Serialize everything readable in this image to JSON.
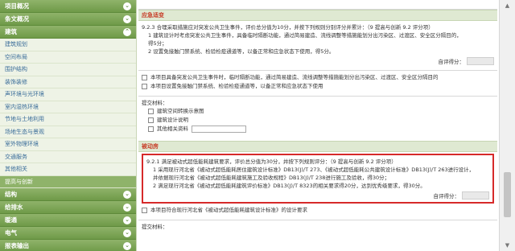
{
  "sidebar": {
    "sections": [
      {
        "label": "项目概况",
        "key": "project"
      },
      {
        "label": "条文概况",
        "key": "clause"
      },
      {
        "label": "建筑",
        "key": "arch"
      }
    ],
    "arch_items": [
      "建筑规划",
      "空间布局",
      "围护结构",
      "装饰装修",
      "声环境与光环境",
      "室内湿热环境",
      "节地与土地利用",
      "场地生态与景观",
      "室外物理环境",
      "交通服务",
      "其他相关",
      "提高与创新"
    ],
    "active_item": "提高与创新",
    "bottom_sections": [
      "结构",
      "给排水",
      "暖通",
      "电气",
      "报表输出"
    ]
  },
  "main": {
    "section1": {
      "title": "应急适变",
      "clause": "9.2.3 合理采取措施应对突发公共卫生事件，评价总分值为10分，并按下列规则分别评分并累计：（9  提高与创新      9.2  评分项）",
      "item1": "1 建筑设计时考虑突发公共卫生事件，具备临时隔断功能，通过简易建造、流线调整等措施能划分出污染区、过渡区、安全区分隔目的，",
      "item1b": "得5分；",
      "item2": "2 设置免接触门禁系统、检验检疫通道等，以备正常和应急状态下使用，得5分。",
      "score_label": "自评得分：",
      "cb1": "本项目具备突发公共卫生事件时，临时隔断功能，通过简易建造、流线调整等措施能划分出污染区、过渡区、安全区分隔目的",
      "cb2": "本项目设置免接触门禁系统、检验检疫通道等，以备正常和应急状态下使用",
      "materials_label": "提交材料：",
      "materials": [
        "建筑空间转换示意图",
        "建筑设计说明",
        "其他相关资料"
      ]
    },
    "section2": {
      "title": "被动房",
      "clause": "9.2.1 满足被动式超低能耗建筑要求，评价总分值为30分，并按下列规则评分：（9  提高与创新      9.2  评分项）",
      "item1": "1 采用现行河北省《被动式超低能耗居住建筑设计标准》DB13(J)/T 273、《被动式超低能耗公共建筑设计标准》DB13(J)/T 263进行设计，",
      "item1b": "并依据现行河北省《被动式超低能耗建筑施工及验收规程》DB13(J)/T 238进行施工及验收，得30分；",
      "item2": "2 满足现行河北省《被动式超低能耗建筑评价标准》DB13(J)/T 8323的相关要求得20分，达到优秀级要求，得30分。",
      "score_label": "自评得分：",
      "cb1": "本项目符合现行河北省《被动式超低能耗建筑设计标准》的设计要求",
      "materials_label": "提交材料："
    }
  },
  "scrollbar": {
    "up": "▲",
    "down": "▼"
  },
  "icons": {
    "chevron": "chevron-down-icon",
    "checkbox": "checkbox-icon"
  },
  "colors": {
    "accent_green": "#8fb36a",
    "heading_red": "#c8402b",
    "highlight_border": "#d62a2a",
    "link_blue": "#3a6d9a"
  }
}
